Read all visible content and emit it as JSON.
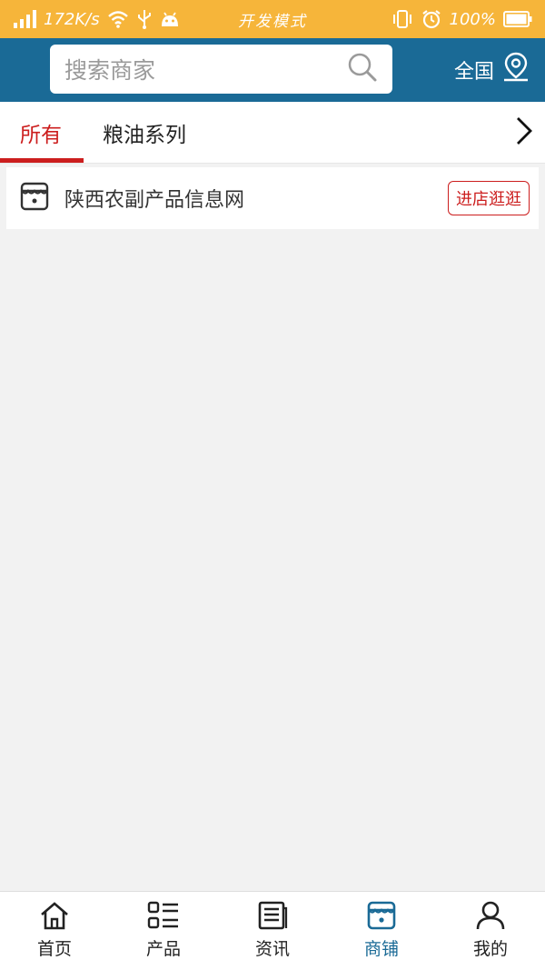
{
  "status_bar": {
    "speed": "172K/s",
    "mode": "开发模式",
    "battery": "100%"
  },
  "header": {
    "search_placeholder": "搜索商家",
    "region": "全国"
  },
  "tabs": [
    {
      "label": "所有",
      "active": true
    },
    {
      "label": "粮油系列",
      "active": false
    }
  ],
  "shops": [
    {
      "name": "陕西农副产品信息网",
      "button_label": "进店逛逛"
    }
  ],
  "bottom_nav": [
    {
      "label": "首页",
      "icon": "home-icon"
    },
    {
      "label": "产品",
      "icon": "list-icon"
    },
    {
      "label": "资讯",
      "icon": "news-icon"
    },
    {
      "label": "商铺",
      "icon": "shop-icon",
      "active": true
    },
    {
      "label": "我的",
      "icon": "user-icon"
    }
  ],
  "colors": {
    "status_bar": "#f6b53a",
    "header": "#1a6a96",
    "accent_red": "#cc1e1e",
    "active_nav": "#1a6a96"
  }
}
